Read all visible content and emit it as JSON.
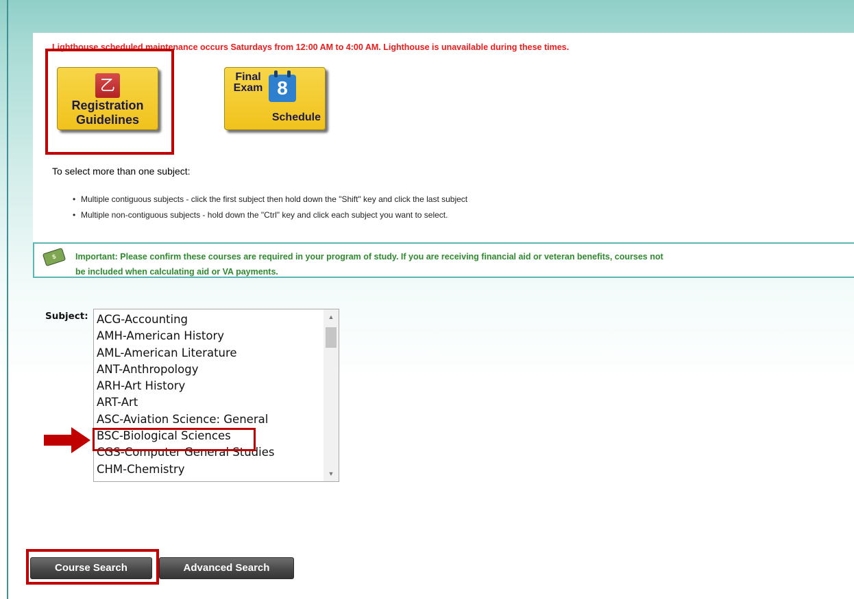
{
  "maintenance_notice": "Lighthouse scheduled maintenance occurs Saturdays from 12:00 AM to 4:00 AM. Lighthouse is unavailable during these times.",
  "registration_guidelines": {
    "line1": "Registration",
    "line2": "Guidelines",
    "icon": "pdf-icon"
  },
  "final_exam": {
    "top1": "Final",
    "top2": "Exam",
    "day": "8",
    "bottom": "Schedule",
    "icon": "calendar-icon"
  },
  "instructions": {
    "title": "To select more than one subject:",
    "bullets": [
      "Multiple contiguous subjects - click the first subject then hold down the \"Shift\" key and click the last subject",
      "Multiple non-contiguous subjects - hold down the \"Ctrl\" key and click each subject you want to select."
    ]
  },
  "important": {
    "line1": "Important: Please confirm these courses are required in your program of study. If you are receiving financial aid or veteran benefits, courses not",
    "line2": "be included when calculating aid or VA payments.",
    "icon": "money-icon"
  },
  "subject": {
    "label": "Subject:",
    "options": [
      "ACG-Accounting",
      "AMH-American History",
      "AML-American Literature",
      "ANT-Anthropology",
      "ARH-Art History",
      "ART-Art",
      "ASC-Aviation Science: General",
      "BSC-Biological Sciences",
      "CGS-Computer General Studies",
      "CHM-Chemistry"
    ]
  },
  "buttons": {
    "course_search": "Course Search",
    "advanced_search": "Advanced Search"
  },
  "colors": {
    "highlight_red": "#c00000",
    "notice_red": "#ee1b1b",
    "important_green": "#2f8a2f",
    "button_gold": "#f1c21c"
  }
}
